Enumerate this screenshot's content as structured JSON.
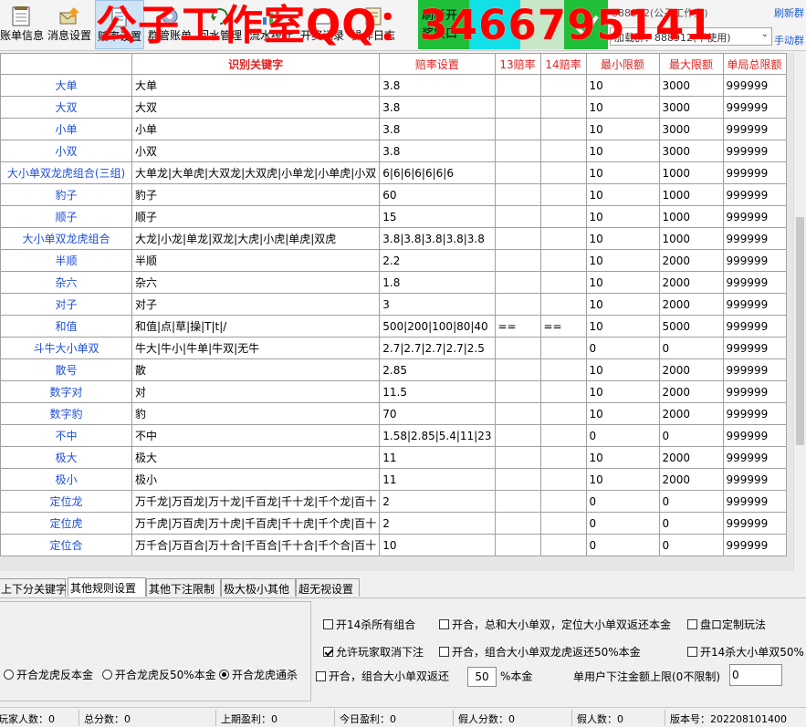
{
  "toolbar": {
    "buttons": [
      {
        "label": "账单信息",
        "icon": "ledger-icon"
      },
      {
        "label": "消息设置",
        "icon": "mail-icon"
      },
      {
        "label": "赔率设置",
        "icon": "odds-doc-icon"
      },
      {
        "label": "群管账单",
        "icon": "group-gear-icon"
      },
      {
        "label": "回水管理",
        "icon": "return-icon"
      },
      {
        "label": "流水统计",
        "icon": "stats-icon"
      },
      {
        "label": "开奖记录",
        "icon": "draw-record-icon"
      },
      {
        "label": "操作日志",
        "icon": "log-icon"
      }
    ],
    "watermark": "公子工作室QQ：3466795141",
    "refresh_button": {
      "line1": "刷新开",
      "line2": "奖接口"
    },
    "group_title": "888912(公子工作室)",
    "group_select": "加载群：888912(不使用)",
    "refresh_link": "刷新群",
    "manual_link": "手动群"
  },
  "grid": {
    "headers": [
      "识别关键字",
      "赔率设置",
      "13赔率",
      "14赔率",
      "最小限额",
      "最大限额",
      "单局总限额"
    ],
    "rows": [
      {
        "cat": "大单",
        "kw": "大单",
        "odds": "3.8",
        "o13": "",
        "o14": "",
        "min": "10",
        "max": "3000",
        "total": "999999"
      },
      {
        "cat": "大双",
        "kw": "大双",
        "odds": "3.8",
        "o13": "",
        "o14": "",
        "min": "10",
        "max": "3000",
        "total": "999999"
      },
      {
        "cat": "小单",
        "kw": "小单",
        "odds": "3.8",
        "o13": "",
        "o14": "",
        "min": "10",
        "max": "3000",
        "total": "999999"
      },
      {
        "cat": "小双",
        "kw": "小双",
        "odds": "3.8",
        "o13": "",
        "o14": "",
        "min": "10",
        "max": "3000",
        "total": "999999"
      },
      {
        "cat": "大小单双龙虎组合(三组)",
        "kw": "大单龙|大单虎|大双龙|大双虎|小单龙|小单虎|小双",
        "odds": "6|6|6|6|6|6|6",
        "o13": "",
        "o14": "",
        "min": "10",
        "max": "1000",
        "total": "999999"
      },
      {
        "cat": "豹子",
        "kw": "豹子",
        "odds": "60",
        "o13": "",
        "o14": "",
        "min": "10",
        "max": "1000",
        "total": "999999"
      },
      {
        "cat": "顺子",
        "kw": "顺子",
        "odds": "15",
        "o13": "",
        "o14": "",
        "min": "10",
        "max": "1000",
        "total": "999999"
      },
      {
        "cat": "大小单双龙虎组合",
        "kw": "大龙|小龙|单龙|双龙|大虎|小虎|单虎|双虎",
        "odds": "3.8|3.8|3.8|3.8|3.8",
        "o13": "",
        "o14": "",
        "min": "10",
        "max": "1000",
        "total": "999999"
      },
      {
        "cat": "半顺",
        "kw": "半顺",
        "odds": "2.2",
        "o13": "",
        "o14": "",
        "min": "10",
        "max": "2000",
        "total": "999999"
      },
      {
        "cat": "杂六",
        "kw": "杂六",
        "odds": "1.8",
        "o13": "",
        "o14": "",
        "min": "10",
        "max": "2000",
        "total": "999999"
      },
      {
        "cat": "对子",
        "kw": "对子",
        "odds": "3",
        "o13": "",
        "o14": "",
        "min": "10",
        "max": "2000",
        "total": "999999"
      },
      {
        "cat": "和值",
        "kw": "和值|点|草|操|T|t|/",
        "odds": "500|200|100|80|40",
        "o13": "==",
        "o14": "==",
        "min": "10",
        "max": "5000",
        "total": "999999"
      },
      {
        "cat": "斗牛大小单双",
        "kw": "牛大|牛小|牛单|牛双|无牛",
        "odds": "2.7|2.7|2.7|2.7|2.5",
        "o13": "",
        "o14": "",
        "min": "0",
        "max": "0",
        "total": "999999"
      },
      {
        "cat": "散号",
        "kw": "散",
        "odds": "2.85",
        "o13": "",
        "o14": "",
        "min": "10",
        "max": "2000",
        "total": "999999"
      },
      {
        "cat": "数字对",
        "kw": "对",
        "odds": "11.5",
        "o13": "",
        "o14": "",
        "min": "10",
        "max": "2000",
        "total": "999999"
      },
      {
        "cat": "数字豹",
        "kw": "豹",
        "odds": "70",
        "o13": "",
        "o14": "",
        "min": "10",
        "max": "2000",
        "total": "999999"
      },
      {
        "cat": "不中",
        "kw": "不中",
        "odds": "1.58|2.85|5.4|11|23",
        "o13": "",
        "o14": "",
        "min": "0",
        "max": "0",
        "total": "999999"
      },
      {
        "cat": "极大",
        "kw": "极大",
        "odds": "11",
        "o13": "",
        "o14": "",
        "min": "10",
        "max": "2000",
        "total": "999999"
      },
      {
        "cat": "极小",
        "kw": "极小",
        "odds": "11",
        "o13": "",
        "o14": "",
        "min": "10",
        "max": "2000",
        "total": "999999"
      },
      {
        "cat": "定位龙",
        "kw": "万千龙|万百龙|万十龙|千百龙|千十龙|千个龙|百十",
        "odds": "2",
        "o13": "",
        "o14": "",
        "min": "0",
        "max": "0",
        "total": "999999"
      },
      {
        "cat": "定位虎",
        "kw": "万千虎|万百虎|万十虎|千百虎|千十虎|千个虎|百十",
        "odds": "2",
        "o13": "",
        "o14": "",
        "min": "0",
        "max": "0",
        "total": "999999"
      },
      {
        "cat": "定位合",
        "kw": "万千合|万百合|万十合|千百合|千十合|千个合|百十",
        "odds": "10",
        "o13": "",
        "o14": "",
        "min": "0",
        "max": "0",
        "total": "999999"
      }
    ]
  },
  "tabs": [
    "上下分关键字",
    "其他规则设置",
    "其他下注限制",
    "极大极小其他",
    "超无视设置"
  ],
  "active_tab": 1,
  "panel": {
    "radio_fanben": "开合龙虎反本金",
    "radio_fan50": "开合龙虎反50%本金",
    "radio_tongsha": "开合龙虎通杀",
    "chk_14sha_all": "开14杀所有组合",
    "chk_allow_cancel": "允许玩家取消下注",
    "chk_kaihe_zuhe_prefix": "开合，组合大小单双返还",
    "chk_kaihe_zuhe_value": "50",
    "chk_kaihe_zuhe_suffix": "%本金",
    "chk_kaihe_zong": "开合，总和大小单双，定位大小单双返还本金",
    "chk_kaihe_longhu": "开合，组合大小单双龙虎返还50%本金",
    "chk_pankou": "盘口定制玩法",
    "chk_14sha_daxiao": "开14杀大小单双50%",
    "limit_label": "单用户下注金额上限(0不限制)",
    "limit_value": "0"
  },
  "status": {
    "players": "玩家人数：0",
    "total_score": "总分数：0",
    "last_profit": "上期盈利：0",
    "today_profit": "今日盈利：0",
    "fake_score": "假人分数：0",
    "fake_count": "假人数：0",
    "version": "版本号：202208101400"
  },
  "colors": {
    "header_red": "#e02020",
    "category_blue": "#1f4fd6",
    "watermark_red": "#ff0000",
    "refresh_green": "#1fbf3a",
    "cyan": "#12e0e8"
  }
}
